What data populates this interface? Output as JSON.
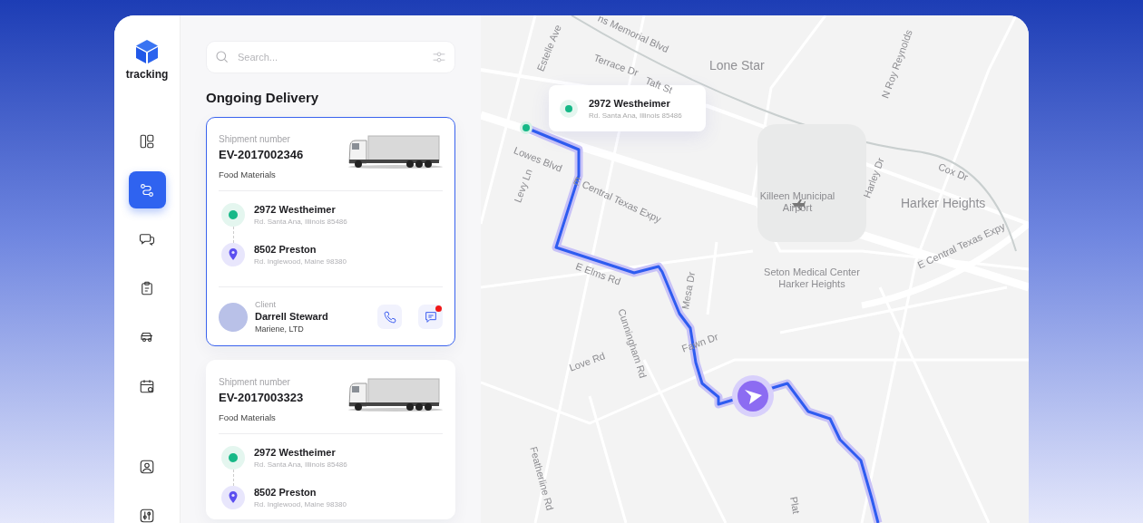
{
  "app": {
    "logo": "tracking"
  },
  "nav": [
    {
      "kind": "dashboard",
      "selected": false
    },
    {
      "kind": "route",
      "selected": true
    },
    {
      "kind": "chat",
      "selected": false
    },
    {
      "kind": "clipboard",
      "selected": false
    },
    {
      "kind": "car",
      "selected": false
    },
    {
      "kind": "calendar",
      "selected": false
    },
    {
      "kind": "user",
      "selected": false
    },
    {
      "kind": "sliders",
      "selected": false
    }
  ],
  "search": {
    "placeholder": "Search..."
  },
  "section_title": "Ongoing Delivery",
  "deliveries": [
    {
      "selected": true,
      "shipment_label": "Shipment number",
      "shipment_number": "EV-2017002346",
      "cargo": "Food Materials",
      "stops": [
        {
          "kind": "origin",
          "title": "2972 Westheimer",
          "subtitle": "Rd. Santa Ana, Illinois 85486"
        },
        {
          "kind": "destination",
          "title": "8502 Preston",
          "subtitle": "Rd. Inglewood, Maine 98380"
        }
      ],
      "client": {
        "label": "Client",
        "name": "Darrell Steward",
        "company": "Mariene, LTD",
        "unread": true
      }
    },
    {
      "selected": false,
      "shipment_label": "Shipment number",
      "shipment_number": "EV-2017003323",
      "cargo": "Food Materials",
      "stops": [
        {
          "kind": "origin",
          "title": "2972 Westheimer",
          "subtitle": "Rd. Santa Ana, Illinois 85486"
        },
        {
          "kind": "destination",
          "title": "8502 Preston",
          "subtitle": "Rd. Inglewood, Maine 98380"
        }
      ]
    }
  ],
  "map": {
    "labels": [
      "ns Memorial Blvd",
      "Terrace Dr",
      "Estelle Ave",
      "Taft St",
      "Lone Star",
      "N Roy Reynolds",
      "Lowes Blvd",
      "E Central Texas Expy",
      "Cox Dr",
      "Levy Ln",
      "Killeen Municipal Airport",
      "Harley Dr",
      "Harker Heights",
      "E Elms Rd",
      "Seton Medical Center Harker Heights",
      "E Central Texas Expy",
      "Mesa Dr",
      "Cunningham Rd",
      "Love Rd",
      "Fawn Dr",
      "Featherline Rd",
      "Plat"
    ],
    "popup": {
      "title": "2972 Westheimer",
      "subtitle": "Rd. Santa Ana, Illinois 85486"
    }
  }
}
